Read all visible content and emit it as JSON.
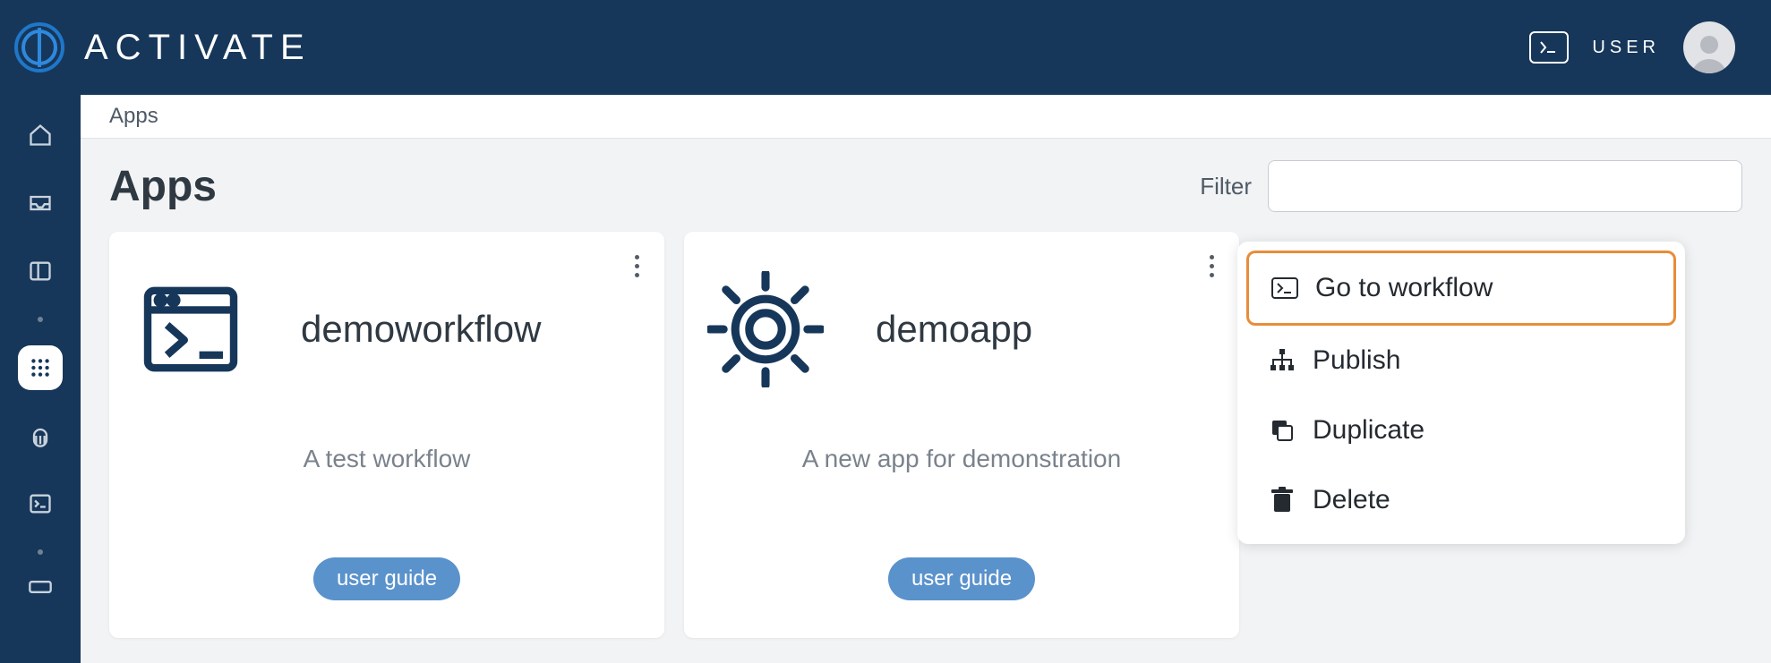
{
  "brand": "ACTIVATE",
  "user_label": "USER",
  "breadcrumb": "Apps",
  "page_title": "Apps",
  "filter_label": "Filter",
  "filter_value": "",
  "cards": [
    {
      "title": "demoworkflow",
      "desc": "A test workflow",
      "guide": "user guide"
    },
    {
      "title": "demoapp",
      "desc": "A new app for demonstration",
      "guide": "user guide"
    }
  ],
  "context_menu": {
    "go_to_workflow": "Go to workflow",
    "publish": "Publish",
    "duplicate": "Duplicate",
    "delete": "Delete"
  }
}
